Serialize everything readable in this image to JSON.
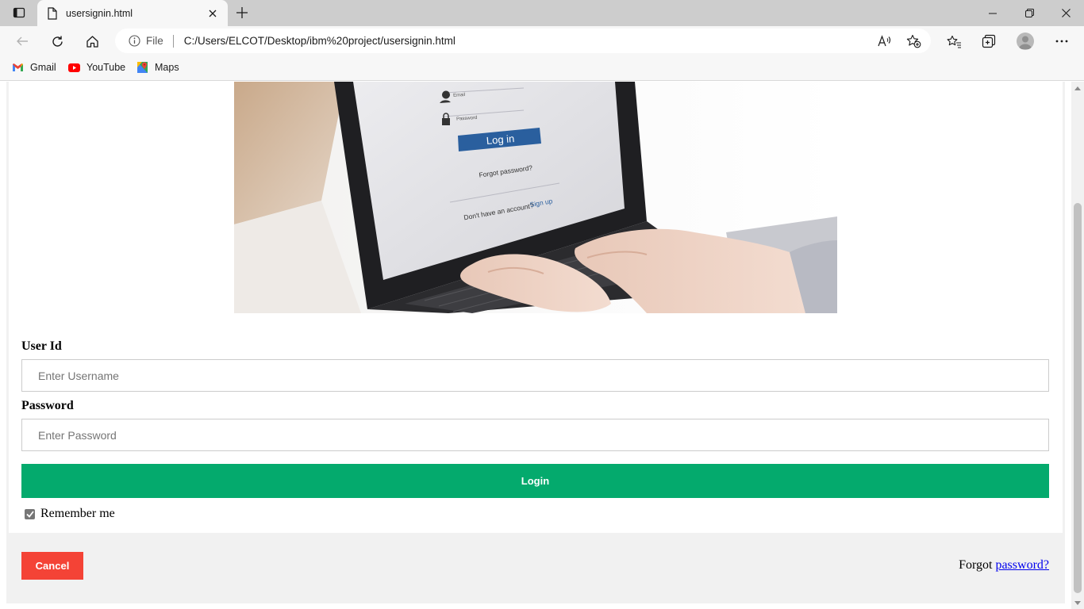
{
  "browser": {
    "tab_title": "usersignin.html",
    "site_info_label": "File",
    "url": "C:/Users/ELCOT/Desktop/ibm%20project/usersignin.html",
    "bookmarks": [
      {
        "label": "Gmail",
        "icon": "gmail-icon"
      },
      {
        "label": "YouTube",
        "icon": "youtube-icon"
      },
      {
        "label": "Maps",
        "icon": "maps-icon"
      }
    ]
  },
  "hero_image": {
    "screen_text": {
      "email_placeholder": "Email",
      "password_placeholder": "Password",
      "login_button": "Log in",
      "forgot_link": "Forgot password?",
      "signup_prompt": "Don't have an account?",
      "signup_link": "Sign up"
    }
  },
  "form": {
    "user_label": "User Id",
    "user_placeholder": "Enter Username",
    "password_label": "Password",
    "password_placeholder": "Enter Password",
    "login_button": "Login",
    "remember_label": "Remember me",
    "remember_checked": true
  },
  "footer": {
    "cancel_button": "Cancel",
    "forgot_prefix": "Forgot",
    "forgot_link": "password?"
  },
  "colors": {
    "login_green": "#04aa6d",
    "cancel_red": "#f44336",
    "link_blue": "#0000ee"
  }
}
